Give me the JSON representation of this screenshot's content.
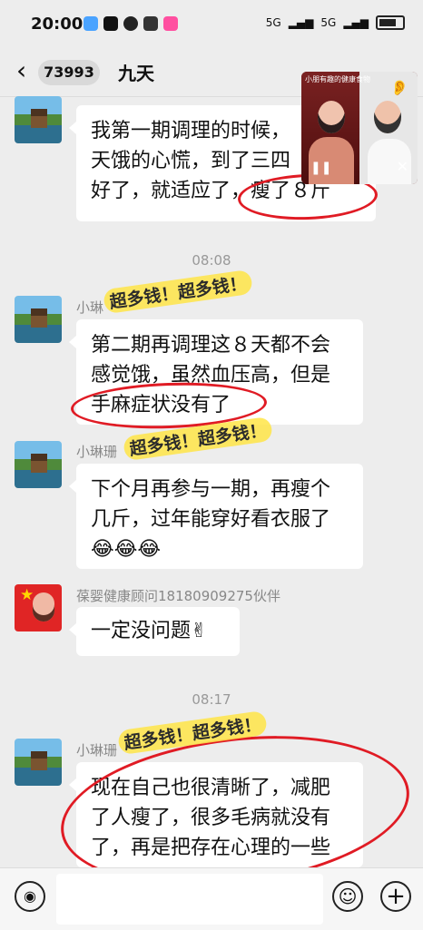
{
  "status": {
    "time": "20:00",
    "network_left": "5G",
    "network_right": "5G",
    "battery": "100"
  },
  "header": {
    "back_icon": "‹",
    "unread": "73993",
    "title": "九天"
  },
  "overlay": {
    "video_caption": "小朋有趣的健康食物",
    "ear_icon": "👂",
    "pause_icon": "❚❚",
    "close_icon": "✕"
  },
  "messages": {
    "m1_line1": "我第一期调理的时候，",
    "m1_line2": "天饿的心慌，到了三四",
    "m1_line3": "好了，就适应了，瘦了８斤",
    "time1": "08:08",
    "sender2": "小琳",
    "m2_line1": "第二期再调理这８天都不会",
    "m2_line2": "感觉饿，虽然血压高，但是",
    "m2_line3": "手麻症状没有了",
    "sender3": "小琳珊",
    "m3_line1": "下个月再参与一期，再瘦个",
    "m3_line2": "几斤，过年能穿好看衣服了",
    "m3_line3": "😂😂😂",
    "sender4": "葆婴健康顾问18180909275伙伴",
    "m4": "一定没问题✌",
    "time2": "08:17",
    "sender5": "小琳珊",
    "m5_line1": "现在自己也很清晰了，减肥",
    "m5_line2": "了人瘦了，很多毛病就没有",
    "m5_line3": "了，再是把存在心理的一些"
  },
  "stickers": {
    "text": "超多钱！超多钱！"
  },
  "input": {
    "voice_icon": "◉",
    "emoji_icon": "☺",
    "plus_icon": "+"
  }
}
